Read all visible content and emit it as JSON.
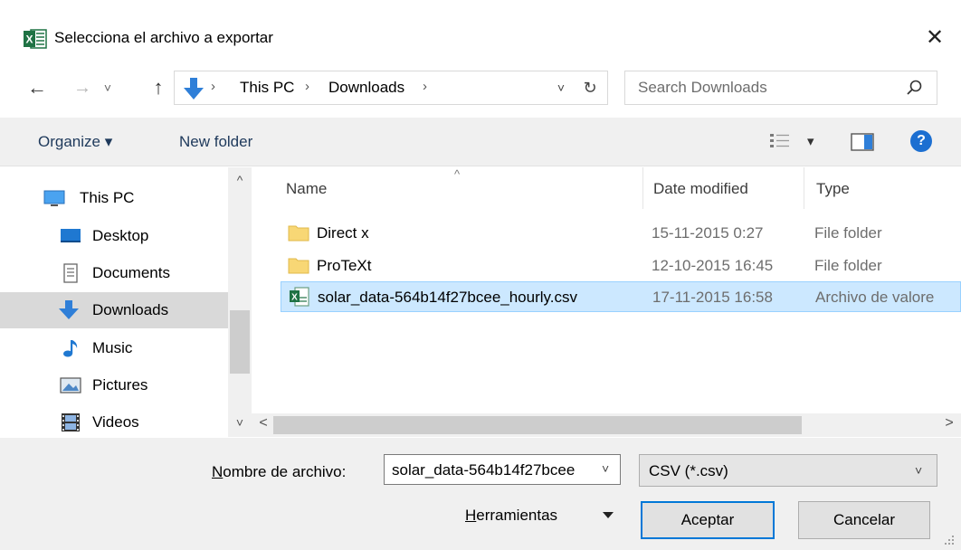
{
  "window": {
    "title": "Selecciona el archivo a exportar",
    "close_glyph": "✕",
    "app_icon": "excel-icon"
  },
  "nav": {
    "back_glyph": "←",
    "forward_glyph": "→",
    "recent_glyph": "˅",
    "up_glyph": "↑",
    "breadcrumbs": [
      "This PC",
      "Downloads"
    ],
    "breadcrumb_sep": "›",
    "dropdown_glyph": "˅",
    "refresh_glyph": "↻",
    "search_placeholder": "Search Downloads"
  },
  "toolbar": {
    "organize": "Organize ▾",
    "new_folder": "New folder",
    "view_caret": "▾",
    "help_glyph": "?"
  },
  "sidebar": {
    "items": [
      {
        "label": "This PC",
        "icon": "computer-icon"
      },
      {
        "label": "Desktop",
        "icon": "desktop-icon"
      },
      {
        "label": "Documents",
        "icon": "documents-icon"
      },
      {
        "label": "Downloads",
        "icon": "downloads-icon",
        "selected": true
      },
      {
        "label": "Music",
        "icon": "music-icon"
      },
      {
        "label": "Pictures",
        "icon": "pictures-icon"
      },
      {
        "label": "Videos",
        "icon": "videos-icon"
      }
    ],
    "scroll_up": "^",
    "scroll_down": "˅"
  },
  "files": {
    "columns": [
      "Name",
      "Date modified",
      "Type"
    ],
    "sort_glyph": "^",
    "rows": [
      {
        "name": "Direct x",
        "date": "15-11-2015 0:27",
        "type": "File folder",
        "icon": "folder-icon"
      },
      {
        "name": "ProTeXt",
        "date": "12-10-2015 16:45",
        "type": "File folder",
        "icon": "folder-icon"
      },
      {
        "name": "solar_data-564b14f27bcee_hourly.csv",
        "date": "17-11-2015 16:58",
        "type": "Archivo de valore",
        "icon": "excel-csv-icon",
        "selected": true
      }
    ],
    "hscroll_left": "<",
    "hscroll_right": ">"
  },
  "footer": {
    "filename_label_u": "N",
    "filename_label_rest": "ombre de archivo:",
    "filename_value": "solar_data-564b14f27bcee",
    "filetype_value": "CSV (*.csv)",
    "combo_glyph": "˅",
    "tools_u": "H",
    "tools_rest": "erramientas",
    "accept": "Aceptar",
    "cancel": "Cancelar"
  },
  "colors": {
    "selection_bg": "#cce8ff",
    "selection_border": "#99d1ff",
    "nav_selected": "#d9d9d9",
    "accent": "#0078d7",
    "excel_green": "#1f7244",
    "folder_yellow": "#f8d775"
  }
}
